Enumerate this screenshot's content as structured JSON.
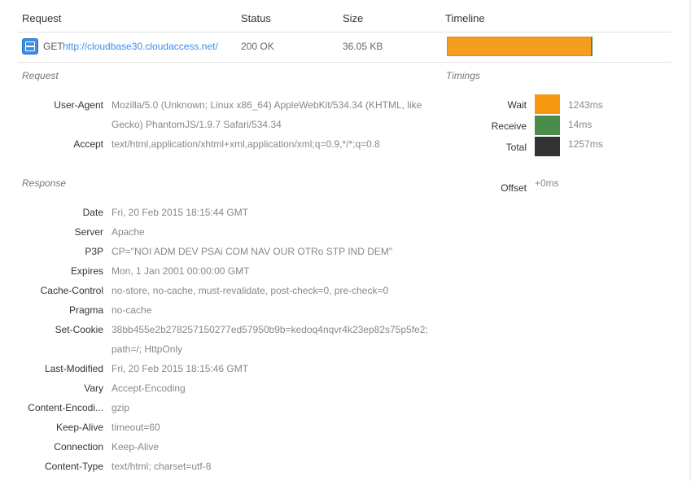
{
  "columns": {
    "request": "Request",
    "status": "Status",
    "size": "Size",
    "timeline": "Timeline"
  },
  "entry": {
    "method": "GET",
    "url": "http://cloudbase30.cloudaccess.net/",
    "status": "200 OK",
    "size": "36.05 KB",
    "timeline_wait_fraction": 0.989,
    "timeline_receive_fraction": 0.011
  },
  "request_section": {
    "title": "Request",
    "headers": [
      {
        "name": "User-Agent",
        "value_line1": "Mozilla/5.0 (Unknown; Linux x86_64) AppleWebKit/534.34 (KHTML, like",
        "value_line2": "Gecko) PhantomJS/1.9.7 Safari/534.34"
      },
      {
        "name": "Accept",
        "value_line1": "text/html,application/xhtml+xml,application/xml;q=0.9,*/*;q=0.8"
      }
    ]
  },
  "timings": {
    "title": "Timings",
    "wait": {
      "label": "Wait",
      "value": "1243ms",
      "color": "#f7970d"
    },
    "receive": {
      "label": "Receive",
      "value": "14ms",
      "color": "#4a8c4a"
    },
    "total": {
      "label": "Total",
      "value": "1257ms",
      "color": "#333333"
    },
    "offset": {
      "label": "Offset",
      "value": "+0ms"
    }
  },
  "response_section": {
    "title": "Response",
    "headers": [
      {
        "name": "Date",
        "value": "Fri, 20 Feb 2015 18:15:44 GMT"
      },
      {
        "name": "Server",
        "value": "Apache"
      },
      {
        "name": "P3P",
        "value": "CP=\"NOI ADM DEV PSAi COM NAV OUR OTRo STP IND DEM\""
      },
      {
        "name": "Expires",
        "value": "Mon, 1 Jan 2001 00:00:00 GMT"
      },
      {
        "name": "Cache-Control",
        "value": "no-store, no-cache, must-revalidate, post-check=0, pre-check=0"
      },
      {
        "name": "Pragma",
        "value": "no-cache"
      },
      {
        "name": "Set-Cookie",
        "value": "38bb455e2b278257150277ed57950b9b=kedoq4nqvr4k23ep82s75p5fe2;",
        "value_line2": "path=/; HttpOnly"
      },
      {
        "name": "Last-Modified",
        "value": "Fri, 20 Feb 2015 18:15:46 GMT"
      },
      {
        "name": "Vary",
        "value": "Accept-Encoding"
      },
      {
        "name": "Content-Encodi...",
        "value": "gzip"
      },
      {
        "name": "Keep-Alive",
        "value": "timeout=60"
      },
      {
        "name": "Connection",
        "value": "Keep-Alive"
      },
      {
        "name": "Content-Type",
        "value": "text/html; charset=utf-8"
      }
    ]
  }
}
